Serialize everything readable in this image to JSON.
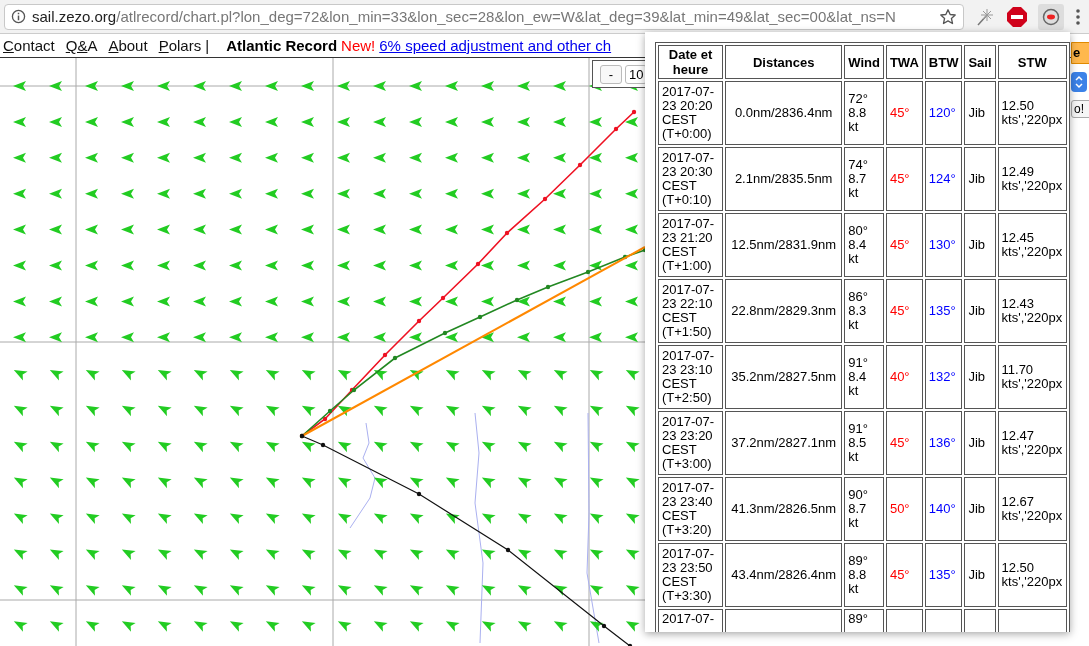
{
  "browser": {
    "url_domain": "sail.zezo.org",
    "url_path": "/atlrecord/chart.pl?lon_deg=72&lon_min=33&lon_sec=28&lon_ew=W&lat_deg=39&lat_min=49&lat_sec=00&lat_ns=N"
  },
  "nav": {
    "links": [
      "Contact",
      "Q&A",
      "About",
      "Polars |"
    ],
    "title": "Atlantic Record",
    "badge": "New!",
    "announcement": "6% speed adjustment and other ch"
  },
  "map": {
    "zoom_minus": "-",
    "zoom_level": "10"
  },
  "right_controls": [
    {
      "kind": "pill",
      "label": "e"
    },
    {
      "kind": "select"
    },
    {
      "kind": "button",
      "label": "o!"
    }
  ],
  "popup": {
    "columns": [
      "Date et heure",
      "Distances",
      "Wind",
      "TWA",
      "BTW",
      "Sail",
      "STW"
    ],
    "rows": [
      {
        "date": "2017-07-23 20:20 CEST (T+0:00)",
        "distances": "0.0nm/2836.4nm",
        "wind": "72° 8.8 kt",
        "twa": "45°",
        "btw": "120°",
        "sail": "Jib",
        "stw": "12.50 kts','220px"
      },
      {
        "date": "2017-07-23 20:30 CEST (T+0:10)",
        "distances": "2.1nm/2835.5nm",
        "wind": "74° 8.7 kt",
        "twa": "45°",
        "btw": "124°",
        "sail": "Jib",
        "stw": "12.49 kts','220px"
      },
      {
        "date": "2017-07-23 21:20 CEST (T+1:00)",
        "distances": "12.5nm/2831.9nm",
        "wind": "80° 8.4 kt",
        "twa": "45°",
        "btw": "130°",
        "sail": "Jib",
        "stw": "12.45 kts','220px"
      },
      {
        "date": "2017-07-23 22:10 CEST (T+1:50)",
        "distances": "22.8nm/2829.3nm",
        "wind": "86° 8.3 kt",
        "twa": "45°",
        "btw": "135°",
        "sail": "Jib",
        "stw": "12.43 kts','220px"
      },
      {
        "date": "2017-07-23 23:10 CEST (T+2:50)",
        "distances": "35.2nm/2827.5nm",
        "wind": "91° 8.4 kt",
        "twa": "40°",
        "btw": "132°",
        "sail": "Jib",
        "stw": "11.70 kts','220px"
      },
      {
        "date": "2017-07-23 23:20 CEST (T+3:00)",
        "distances": "37.2nm/2827.1nm",
        "wind": "91° 8.5 kt",
        "twa": "45°",
        "btw": "136°",
        "sail": "Jib",
        "stw": "12.47 kts','220px"
      },
      {
        "date": "2017-07-23 23:40 CEST (T+3:20)",
        "distances": "41.3nm/2826.5nm",
        "wind": "90° 8.7 kt",
        "twa": "50°",
        "btw": "140°",
        "sail": "Jib",
        "stw": "12.67 kts','220px"
      },
      {
        "date": "2017-07-23 23:50 CEST (T+3:30)",
        "distances": "43.4nm/2826.4nm",
        "wind": "89° 8.8 kt",
        "twa": "45°",
        "btw": "135°",
        "sail": "Jib",
        "stw": "12.50 kts','220px"
      },
      {
        "date": "2017-07-",
        "wind": "89°"
      }
    ]
  }
}
